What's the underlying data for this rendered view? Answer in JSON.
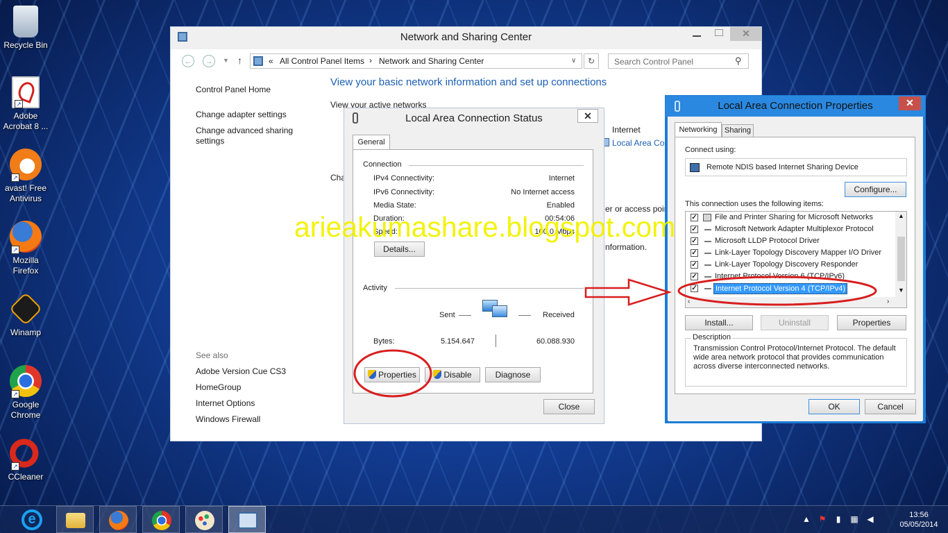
{
  "desktop": {
    "icons": [
      {
        "label": "Recycle Bin"
      },
      {
        "label": "Adobe\nAcrobat 8 ..."
      },
      {
        "label": "avast! Free\nAntivirus"
      },
      {
        "label": "Mozilla\nFirefox"
      },
      {
        "label": "Winamp"
      },
      {
        "label": "Google\nChrome"
      },
      {
        "label": "CCleaner"
      }
    ],
    "watermark": "arieakumashare.blogspot.com"
  },
  "nsc": {
    "title": "Network and Sharing Center",
    "breadcrumb": [
      "«",
      "All Control Panel Items",
      "Network and Sharing Center"
    ],
    "search_placeholder": "Search Control Panel",
    "sidebar": [
      "Control Panel Home",
      "Change adapter settings",
      "Change advanced sharing\nsettings"
    ],
    "see_also_title": "See also",
    "see_also": [
      "Adobe Version Cue CS3",
      "HomeGroup",
      "Internet Options",
      "Windows Firewall"
    ],
    "heading": "View your basic network information and set up connections",
    "active_networks": "View your active networks",
    "access_type": "Internet",
    "connection_link": "Local Area Co",
    "partial_cha": "Cha",
    "partial_access": "er or access poin",
    "partial_info": "nformation."
  },
  "status": {
    "title": "Local Area Connection Status",
    "tab": "General",
    "connection_section": "Connection",
    "rows": [
      {
        "label": "IPv4 Connectivity:",
        "value": "Internet"
      },
      {
        "label": "IPv6 Connectivity:",
        "value": "No Internet access"
      },
      {
        "label": "Media State:",
        "value": "Enabled"
      },
      {
        "label": "Duration:",
        "value": "00:54:06"
      },
      {
        "label": "Speed:",
        "value": "100.0 Mbps"
      }
    ],
    "details_btn": "Details...",
    "activity_section": "Activity",
    "sent_label": "Sent",
    "received_label": "Received",
    "bytes_label": "Bytes:",
    "bytes_sent": "5.154.647",
    "bytes_received": "60.088.930",
    "properties_btn": "Properties",
    "disable_btn": "Disable",
    "diagnose_btn": "Diagnose",
    "close_btn": "Close"
  },
  "props": {
    "title": "Local Area Connection Properties",
    "tabs": [
      "Networking",
      "Sharing"
    ],
    "connect_using_label": "Connect using:",
    "device": "Remote NDIS based Internet Sharing Device",
    "configure_btn": "Configure...",
    "items_label": "This connection uses the following items:",
    "items": [
      {
        "label": "File and Printer Sharing for Microsoft Networks",
        "checked": true
      },
      {
        "label": "Microsoft Network Adapter Multiplexor Protocol",
        "checked": true
      },
      {
        "label": "Microsoft LLDP Protocol Driver",
        "checked": true
      },
      {
        "label": "Link-Layer Topology Discovery Mapper I/O Driver",
        "checked": true
      },
      {
        "label": "Link-Layer Topology Discovery Responder",
        "checked": true
      },
      {
        "label": "Internet Protocol Version 6 (TCP/IPv6)",
        "checked": true
      },
      {
        "label": "Internet Protocol Version 4 (TCP/IPv4)",
        "checked": true,
        "selected": true
      }
    ],
    "install_btn": "Install...",
    "uninstall_btn": "Uninstall",
    "properties_btn": "Properties",
    "description_title": "Description",
    "description": "Transmission Control Protocol/Internet Protocol. The default wide area network protocol that provides communication across diverse interconnected networks.",
    "ok_btn": "OK",
    "cancel_btn": "Cancel"
  },
  "taskbar": {
    "time": "13:56",
    "date": "05/05/2014"
  },
  "colors": {
    "accent_blue": "#1c5fb4",
    "annotation_red": "#d81e1e",
    "watermark_yellow": "#f2f200",
    "selection": "#3399ff"
  }
}
